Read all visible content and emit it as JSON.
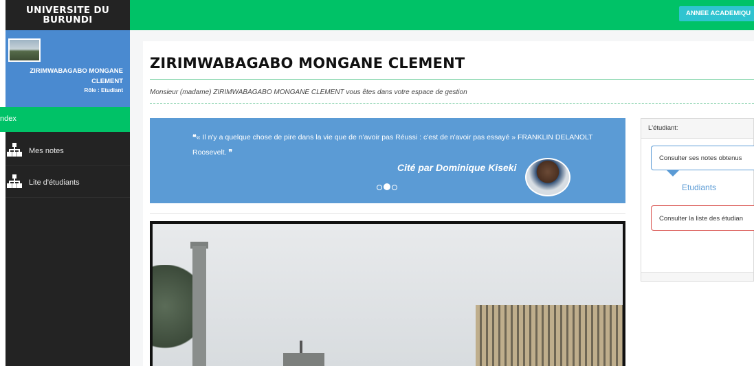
{
  "sidebar": {
    "brand_line1": "UNIVERSITE DU",
    "brand_line2": "BURUNDI",
    "user_name": "ZIRIMWABAGABO MONGANE CLEMENT",
    "user_role": "Rôle : Etudiant",
    "active_item": "ndex",
    "items": [
      {
        "label": "Mes notes",
        "icon": "sitemap-icon"
      },
      {
        "label": "Lite d'étudiants",
        "icon": "sitemap-icon"
      }
    ]
  },
  "topbar": {
    "annee_button": "ANNEE ACADEMIQU"
  },
  "main": {
    "title": "ZIRIMWABAGABO MONGANE CLEMENT",
    "welcome": "Monsieur (madame) ZIRIMWABAGABO MONGANE CLEMENT vous êtes dans votre espace de gestion",
    "quote": {
      "open_mark": "❝",
      "text": "« Il n'y a quelque chose de pire dans la vie que de n'avoir pas Réussi : c'est de n'avoir pas essayé » FRANKLIN DELANOLT Roosevelt.",
      "close_mark": "❞",
      "cite": "Cité par Dominique Kiseki",
      "active_slide": 2,
      "slide_count": 3
    }
  },
  "side_card": {
    "header": "L'étudiant:",
    "notes_box": "Consulter ses notes obtenus",
    "etudiants_label": "Etudiants",
    "list_box": "Consulter la liste des étudian"
  },
  "colors": {
    "green": "#00c267",
    "blue": "#5b9bd5",
    "sidebar": "#232323",
    "teal_button": "#2fc4d0",
    "red_border": "#d9534f"
  }
}
